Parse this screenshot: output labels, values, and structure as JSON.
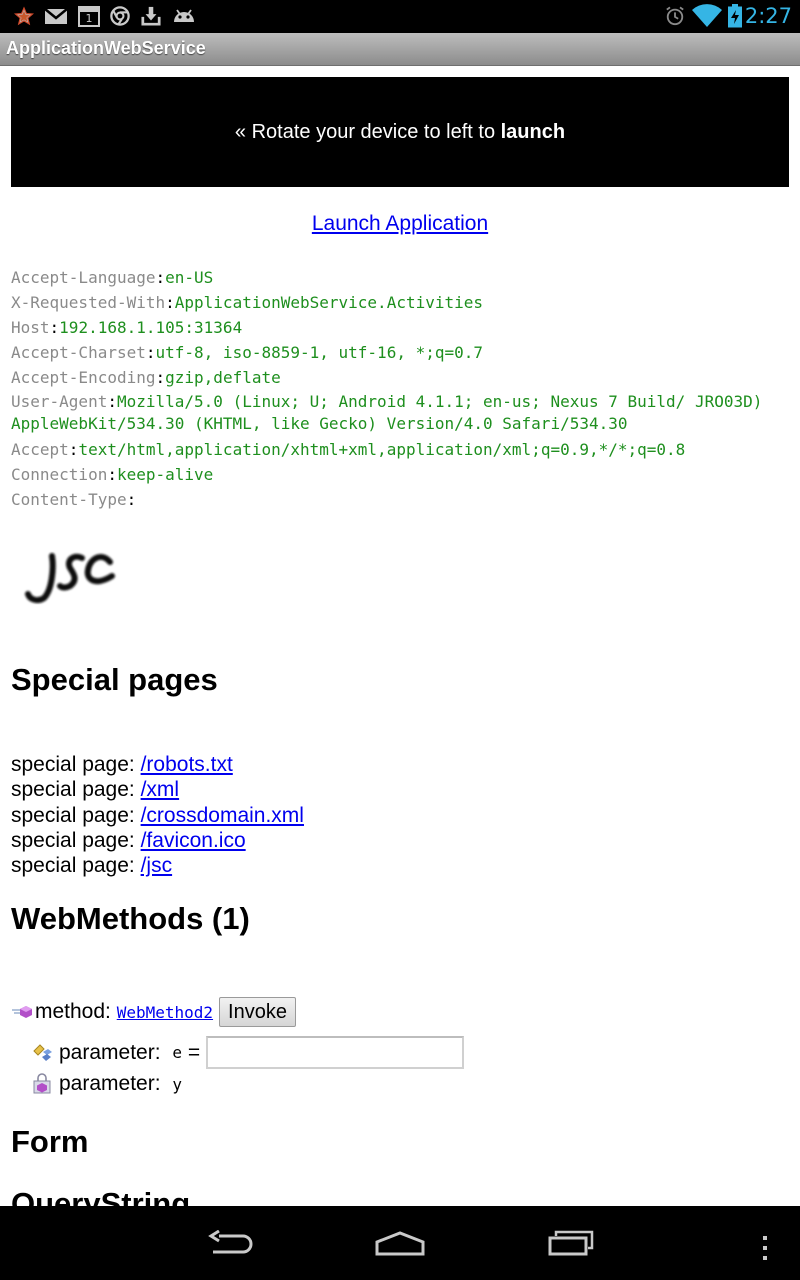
{
  "status_bar": {
    "time": "2:27",
    "left_icons": [
      "star-icon",
      "gmail-icon",
      "calendar-icon",
      "chrome-icon",
      "download-icon",
      "android-icon"
    ],
    "right_icons": [
      "alarm-icon",
      "wifi-icon",
      "battery-icon"
    ],
    "calendar_day": "1",
    "accent": "#35b5e5"
  },
  "action_bar": {
    "title": "ApplicationWebService"
  },
  "banner": {
    "prefix": "« Rotate your device to left to ",
    "bold": "launch"
  },
  "launch_link": "Launch Application",
  "headers": [
    {
      "key": "Accept-Language",
      "value": "en-US"
    },
    {
      "key": "X-Requested-With",
      "value": "ApplicationWebService.Activities"
    },
    {
      "key": "Host",
      "value": "192.168.1.105:31364"
    },
    {
      "key": "Accept-Charset",
      "value": "utf-8, iso-8859-1, utf-16, *;q=0.7"
    },
    {
      "key": "Accept-Encoding",
      "value": "gzip,deflate"
    },
    {
      "key": "User-Agent",
      "value": "Mozilla/5.0 (Linux; U; Android 4.1.1; en-us; Nexus 7 Build/ JRO03D) AppleWebKit/534.30 (KHTML, like Gecko) Version/4.0 Safari/534.30"
    },
    {
      "key": "Accept",
      "value": "text/html,application/xhtml+xml,application/xml;q=0.9,*/*;q=0.8"
    },
    {
      "key": "Connection",
      "value": "keep-alive"
    },
    {
      "key": "Content-Type",
      "value": ""
    }
  ],
  "logo_text": "JSC",
  "special_pages": {
    "heading": "Special pages",
    "prefix": "special page: ",
    "links": [
      "/robots.txt",
      "/xml",
      "/crossdomain.xml",
      "/favicon.ico",
      "/jsc"
    ]
  },
  "webmethods": {
    "heading": "WebMethods (1)",
    "method_label": "method: ",
    "method_name": "WebMethod2",
    "invoke_label": "Invoke",
    "params": [
      {
        "label": "parameter: ",
        "name": "e",
        "suffix": " =",
        "value": ""
      },
      {
        "label": "parameter: ",
        "name": "y"
      }
    ]
  },
  "form_heading": "Form",
  "querystring_heading": "QueryString"
}
